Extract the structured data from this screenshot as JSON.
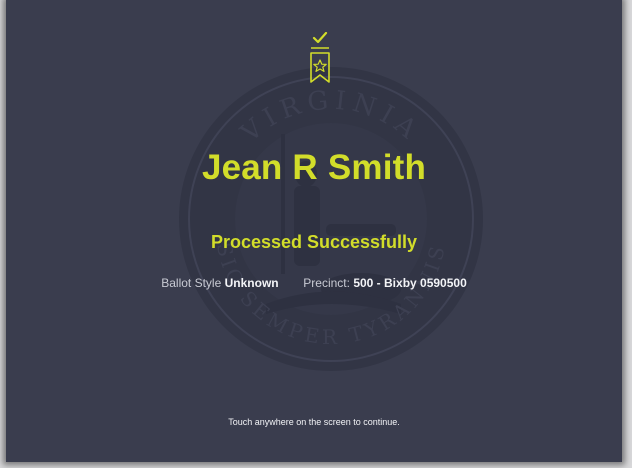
{
  "screen": {
    "voter_name": "Jean R Smith",
    "status_text": "Processed Successfully",
    "ballot_style_label": "Ballot Style",
    "ballot_style_value": "Unknown",
    "precinct_label": "Precinct:",
    "precinct_value": "500 - Bixby 0590500",
    "continue_hint": "Touch anywhere on the screen to continue."
  },
  "seal": {
    "top_text": "VIRGINIA",
    "motto": "SIC SEMPER TYRANNIS"
  },
  "colors": {
    "background": "#3a3d4e",
    "accent": "#d2dd2a",
    "text": "#f3f4f7"
  },
  "icons": {
    "badge": "bookmark-star-check-icon"
  }
}
